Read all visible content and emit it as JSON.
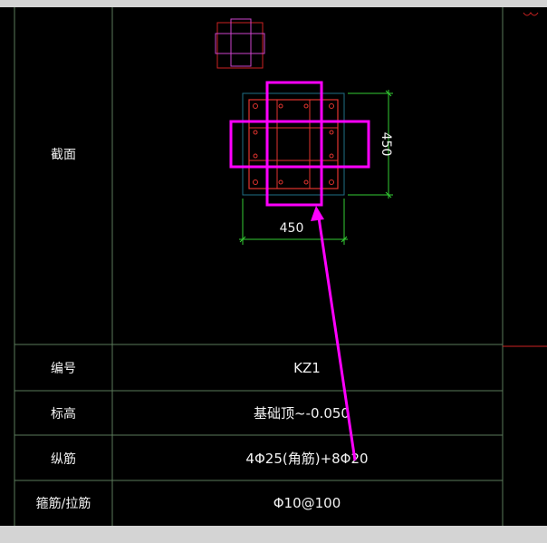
{
  "table": {
    "rows": [
      {
        "label": "截面",
        "value": ""
      },
      {
        "label": "编号",
        "value": "KZ1"
      },
      {
        "label": "标高",
        "value": "基础顶~-0.050"
      },
      {
        "label": "纵筋",
        "value": "4Φ25(角筋)+8Φ20"
      },
      {
        "label": "箍筋/拉筋",
        "value": "Φ10@100"
      }
    ]
  },
  "section": {
    "width_dim": "450",
    "height_dim": "450"
  },
  "colors": {
    "annotation": "#ff00ff",
    "grid_line": "#5a7a5a",
    "dimension": "#33cc33",
    "concrete_outline": "#1f6f86",
    "rebar": "#e3342f"
  }
}
